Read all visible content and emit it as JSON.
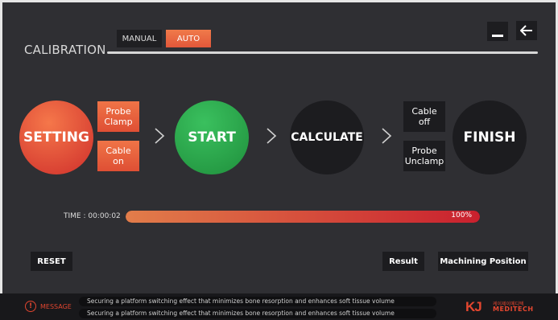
{
  "header": {
    "title": "CALIBRATION",
    "mode_manual": "MANUAL",
    "mode_auto": "AUTO",
    "minimize_icon": "minimize-icon",
    "back_icon": "back-arrow-icon"
  },
  "steps": {
    "setting": "SETTING",
    "probe_clamp_line1": "Probe",
    "probe_clamp_line2": "Clamp",
    "cable_on_line1": "Cable",
    "cable_on_line2": "on",
    "start": "START",
    "calculate": "CALCULATE",
    "cable_off_line1": "Cable",
    "cable_off_line2": "off",
    "probe_unclamp_line1": "Probe",
    "probe_unclamp_line2": "Unclamp",
    "finish": "FINISH"
  },
  "progress": {
    "time_label": "TIME : 00:00:02",
    "percent_label": "100%",
    "fraction": 1.0
  },
  "actions": {
    "reset": "RESET",
    "result": "Result",
    "machining_position": "Machining Position"
  },
  "footer": {
    "message_label": "MESSAGE",
    "message_line1": "Securing a platform switching effect that minimizes bone resorption and enhances soft tissue volume",
    "message_line2": "Securing a platform switching effect that minimizes bone resorption and enhances soft tissue volume",
    "logo_mark": "KJ",
    "logo_korean": "케이제이메디텍",
    "logo_name": "MEDITECH"
  },
  "colors": {
    "accent": "#e2573a",
    "start_green": "#2aa84a",
    "background": "#2f2f33"
  }
}
